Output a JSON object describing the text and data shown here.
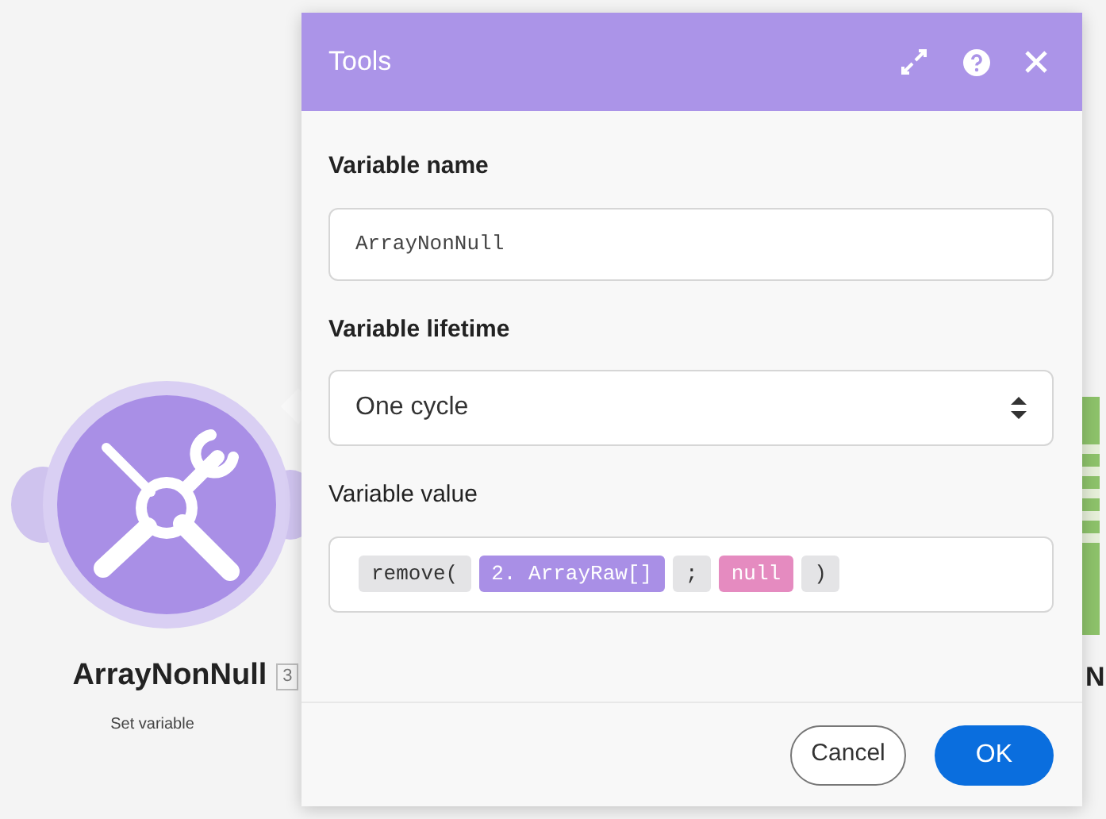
{
  "canvas": {
    "node": {
      "title": "ArrayNonNull",
      "badge": "3",
      "subtitle": "Set variable"
    },
    "partial_node": {
      "title": "N"
    }
  },
  "dialog": {
    "title": "Tools",
    "fields": [
      {
        "kind": "text",
        "label": "Variable name",
        "value": "ArrayNonNull"
      },
      {
        "kind": "select",
        "label": "Variable lifetime",
        "value": "One cycle"
      },
      {
        "kind": "tokens",
        "label": "Variable value",
        "tokens": [
          {
            "kind": "function",
            "text": "remove("
          },
          {
            "kind": "variable",
            "text": "2. ArrayRaw[]"
          },
          {
            "kind": "function",
            "text": ";"
          },
          {
            "kind": "keyword",
            "text": "null"
          },
          {
            "kind": "function",
            "text": ")"
          }
        ]
      }
    ],
    "buttons": [
      {
        "kind": "secondary",
        "label": "Cancel"
      },
      {
        "kind": "primary",
        "label": "OK"
      }
    ]
  }
}
